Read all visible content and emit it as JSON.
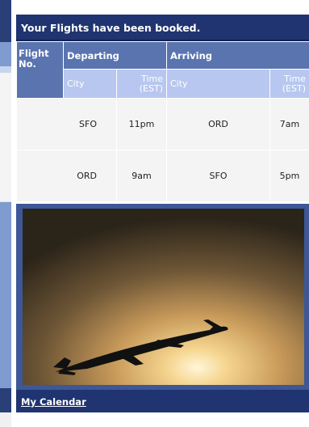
{
  "banner": {
    "title": "Your Flights have been booked."
  },
  "table": {
    "flight_no_header": "Flight No.",
    "departing_header": "Departing",
    "arriving_header": "Arriving",
    "city_label": "City",
    "time_label": "Time (EST)",
    "rows": [
      {
        "dep_city": "SFO",
        "dep_time": "11pm",
        "arr_city": "ORD",
        "arr_time": "7am"
      },
      {
        "dep_city": "ORD",
        "dep_time": "9am",
        "arr_city": "SFO",
        "arr_time": "5pm"
      }
    ]
  },
  "photo": {
    "subject": "airplane-silhouette-at-sunset"
  },
  "footer": {
    "calendar_link": "My Calendar"
  },
  "colors": {
    "banner": "#1f3470",
    "header": "#5a74b0",
    "subheader": "#b8c7ef",
    "row": "#f4f4f4",
    "frame": "#3d5797"
  }
}
